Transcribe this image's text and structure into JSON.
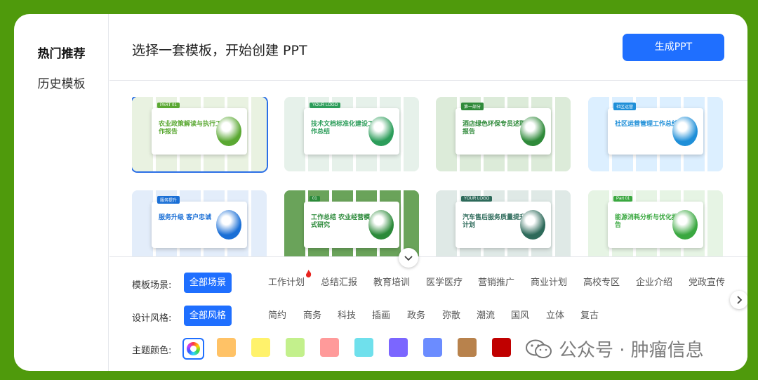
{
  "sidebar": {
    "items": [
      {
        "label": "热门推荐",
        "active": true
      },
      {
        "label": "历史模板",
        "active": false
      }
    ]
  },
  "header": {
    "title": "选择一套模板，开始创建 PPT",
    "generate_label": "生成PPT"
  },
  "templates": [
    {
      "tag": "PART 01",
      "title": "农业政策解读与执行工作报告",
      "accent": "#5aa832",
      "tile": "#e9f2e1",
      "selected": true
    },
    {
      "tag": "YOUR LOGO",
      "title": "技术文档标准化建设工作总结",
      "accent": "#2c9d5a",
      "tile": "#e6f1ea",
      "selected": false
    },
    {
      "tag": "第一部分",
      "title": "酒店绿色环保专员述职报告",
      "accent": "#2f8a3a",
      "tile": "#dcebd9",
      "selected": false
    },
    {
      "tag": "社区运营",
      "title": "社区运营管理工作总结",
      "accent": "#1f8fd8",
      "tile": "#dcefff",
      "selected": false
    },
    {
      "tag": "服务提升",
      "title": "服务升级 客户忠诚",
      "accent": "#1a6fd6",
      "tile": "#e3edfa",
      "selected": false
    },
    {
      "tag": "01",
      "title": "工作总结 农业经营模式研究",
      "accent": "#2c8a3a",
      "tile": "#6aa35a",
      "selected": false
    },
    {
      "tag": "YOUR LOGO",
      "title": "汽车售后服务质量提升计划",
      "accent": "#2d6a5a",
      "tile": "#dfe9e6",
      "selected": false
    },
    {
      "tag": "Part 01",
      "title": "能源消耗分析与优化报告",
      "accent": "#3aa840",
      "tile": "#e6f4e4",
      "selected": false
    }
  ],
  "filters": {
    "scene_label": "模板场景:",
    "scenes": [
      {
        "label": "全部场景",
        "active": true
      },
      {
        "label": "工作计划",
        "active": false,
        "hot": true
      },
      {
        "label": "总结汇报",
        "active": false
      },
      {
        "label": "教育培训",
        "active": false
      },
      {
        "label": "医学医疗",
        "active": false
      },
      {
        "label": "营销推广",
        "active": false
      },
      {
        "label": "商业计划",
        "active": false
      },
      {
        "label": "高校专区",
        "active": false
      },
      {
        "label": "企业介绍",
        "active": false
      },
      {
        "label": "党政宣传",
        "active": false
      }
    ],
    "style_label": "设计风格:",
    "styles": [
      {
        "label": "全部风格",
        "active": true
      },
      {
        "label": "简约",
        "active": false
      },
      {
        "label": "商务",
        "active": false
      },
      {
        "label": "科技",
        "active": false
      },
      {
        "label": "插画",
        "active": false
      },
      {
        "label": "政务",
        "active": false
      },
      {
        "label": "弥散",
        "active": false
      },
      {
        "label": "潮流",
        "active": false
      },
      {
        "label": "国风",
        "active": false
      },
      {
        "label": "立体",
        "active": false
      },
      {
        "label": "复古",
        "active": false
      }
    ],
    "color_label": "主题颜色:",
    "colors": [
      "#ffc266",
      "#fff26b",
      "#c3f08c",
      "#ff9a9a",
      "#6fe0ec",
      "#7b66ff",
      "#6b8cff",
      "#b8824c",
      "#c00000"
    ]
  },
  "watermark": "公众号 · 肿瘤信息",
  "icons": {
    "expand": "chevron-down-icon",
    "scroll_right": "chevron-right-icon",
    "hot": "fire-icon",
    "all_colors": "color-wheel-icon",
    "wechat": "wechat-icon"
  },
  "colors": {
    "background": "#4f9a0c",
    "primary": "#1f6fff"
  }
}
